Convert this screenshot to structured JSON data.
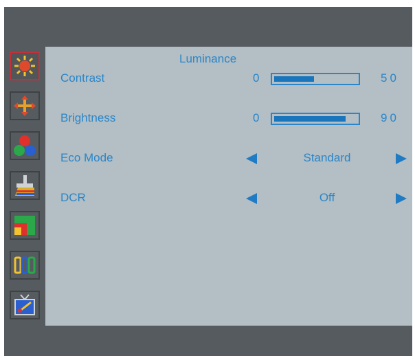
{
  "osd": {
    "title": "Luminance",
    "icons": [
      "luminance-icon",
      "image-setup-icon",
      "color-temp-icon",
      "color-boost-icon",
      "picture-boost-icon",
      "osd-setup-icon",
      "extra-icon"
    ],
    "active_icon": "luminance-icon",
    "rows": [
      {
        "label": "Contrast",
        "type": "slider",
        "min": "0",
        "value": 50,
        "max_display": "50"
      },
      {
        "label": "Brightness",
        "type": "slider",
        "min": "0",
        "value": 90,
        "max_display": "90"
      },
      {
        "label": "Eco Mode",
        "type": "option",
        "value": "Standard"
      },
      {
        "label": "DCR",
        "type": "option",
        "value": "Off"
      }
    ]
  },
  "colors": {
    "text": "#2a86c8",
    "panel": "#b3bec5",
    "frame": "#565b5f",
    "active_border": "#c2303a"
  }
}
